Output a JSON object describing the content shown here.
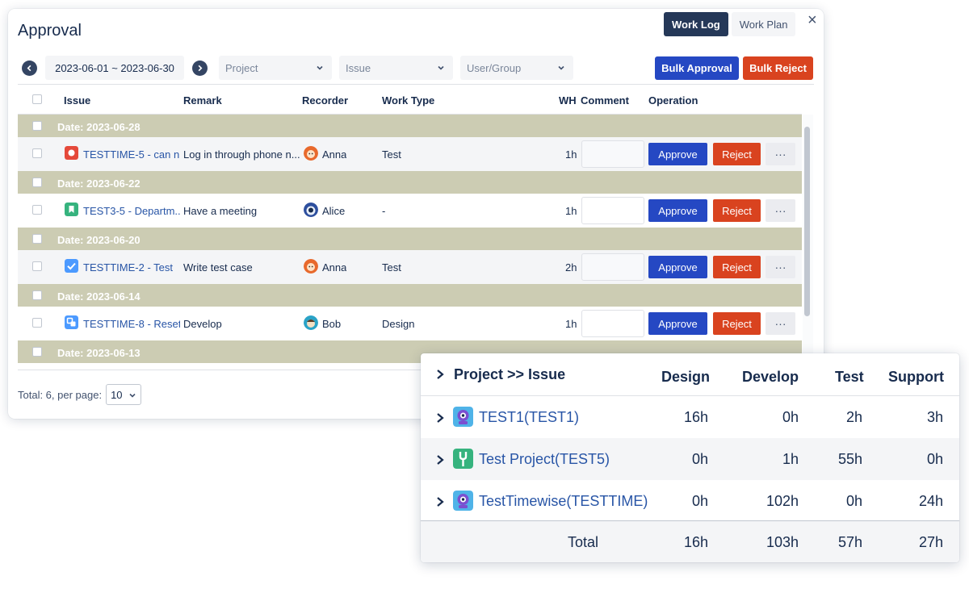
{
  "approval": {
    "title": "Approval",
    "tabs": [
      {
        "label": "Work Log",
        "active": true
      },
      {
        "label": "Work Plan",
        "active": false
      }
    ],
    "close_glyph": "×",
    "filters": {
      "date_range": "2023-06-01 ~ 2023-06-30",
      "project_placeholder": "Project",
      "issue_placeholder": "Issue",
      "user_group_placeholder": "User/Group"
    },
    "bulk_approval_label": "Bulk Approval",
    "bulk_reject_label": "Bulk Reject",
    "colors": {
      "approve": "#2548c3",
      "reject": "#d9431f",
      "group_row": "#ccccb3",
      "dark": "#253858"
    },
    "columns": {
      "issue": "Issue",
      "remark": "Remark",
      "recorder": "Recorder",
      "work_type": "Work Type",
      "wh": "WH",
      "comment": "Comment",
      "operation": "Operation"
    },
    "groups": [
      {
        "date_label": "Date: 2023-06-28",
        "row": {
          "issue": "TESTTIME-5 - can n...",
          "issue_icon": "bug-icon",
          "remark": "Log in through phone n...",
          "recorder": "Anna",
          "avatar": "anna-avatar",
          "work_type": "Test",
          "wh": "1h"
        }
      },
      {
        "date_label": "Date: 2023-06-22",
        "row": {
          "issue": "TEST3-5 - Departm...",
          "issue_icon": "story-icon",
          "remark": "Have a meeting",
          "recorder": "Alice",
          "avatar": "alice-avatar",
          "work_type": "-",
          "wh": "1h"
        }
      },
      {
        "date_label": "Date: 2023-06-20",
        "row": {
          "issue": "TESTTIME-2 - Test",
          "issue_icon": "task-icon",
          "remark": "Write test case",
          "recorder": "Anna",
          "avatar": "anna-avatar",
          "work_type": "Test",
          "wh": "2h"
        }
      },
      {
        "date_label": "Date: 2023-06-14",
        "row": {
          "issue": "TESTTIME-8 - Reset...",
          "issue_icon": "subtask-icon",
          "remark": "Develop",
          "recorder": "Bob",
          "avatar": "bob-avatar",
          "work_type": "Design",
          "wh": "1h"
        }
      },
      {
        "date_label": "Date: 2023-06-13"
      }
    ],
    "approve_label": "Approve",
    "reject_label": "Reject",
    "more_glyph": "···",
    "footer": {
      "total_text": "Total: 6, per page:",
      "per_page": "10"
    }
  },
  "summary": {
    "header": {
      "project_issue": "Project >> Issue",
      "design": "Design",
      "develop": "Develop",
      "test": "Test",
      "support": "Support"
    },
    "rows": [
      {
        "project": "TEST1(TEST1)",
        "icon": "robot-icon",
        "design": "16h",
        "develop": "0h",
        "test": "2h",
        "support": "3h"
      },
      {
        "project": "Test Project(TEST5)",
        "icon": "wrench-icon",
        "design": "0h",
        "develop": "1h",
        "test": "55h",
        "support": "0h"
      },
      {
        "project": "TestTimewise(TESTTIME)",
        "icon": "robot-icon",
        "design": "0h",
        "develop": "102h",
        "test": "0h",
        "support": "24h"
      }
    ],
    "total": {
      "label": "Total",
      "design": "16h",
      "develop": "103h",
      "test": "57h",
      "support": "27h"
    }
  }
}
